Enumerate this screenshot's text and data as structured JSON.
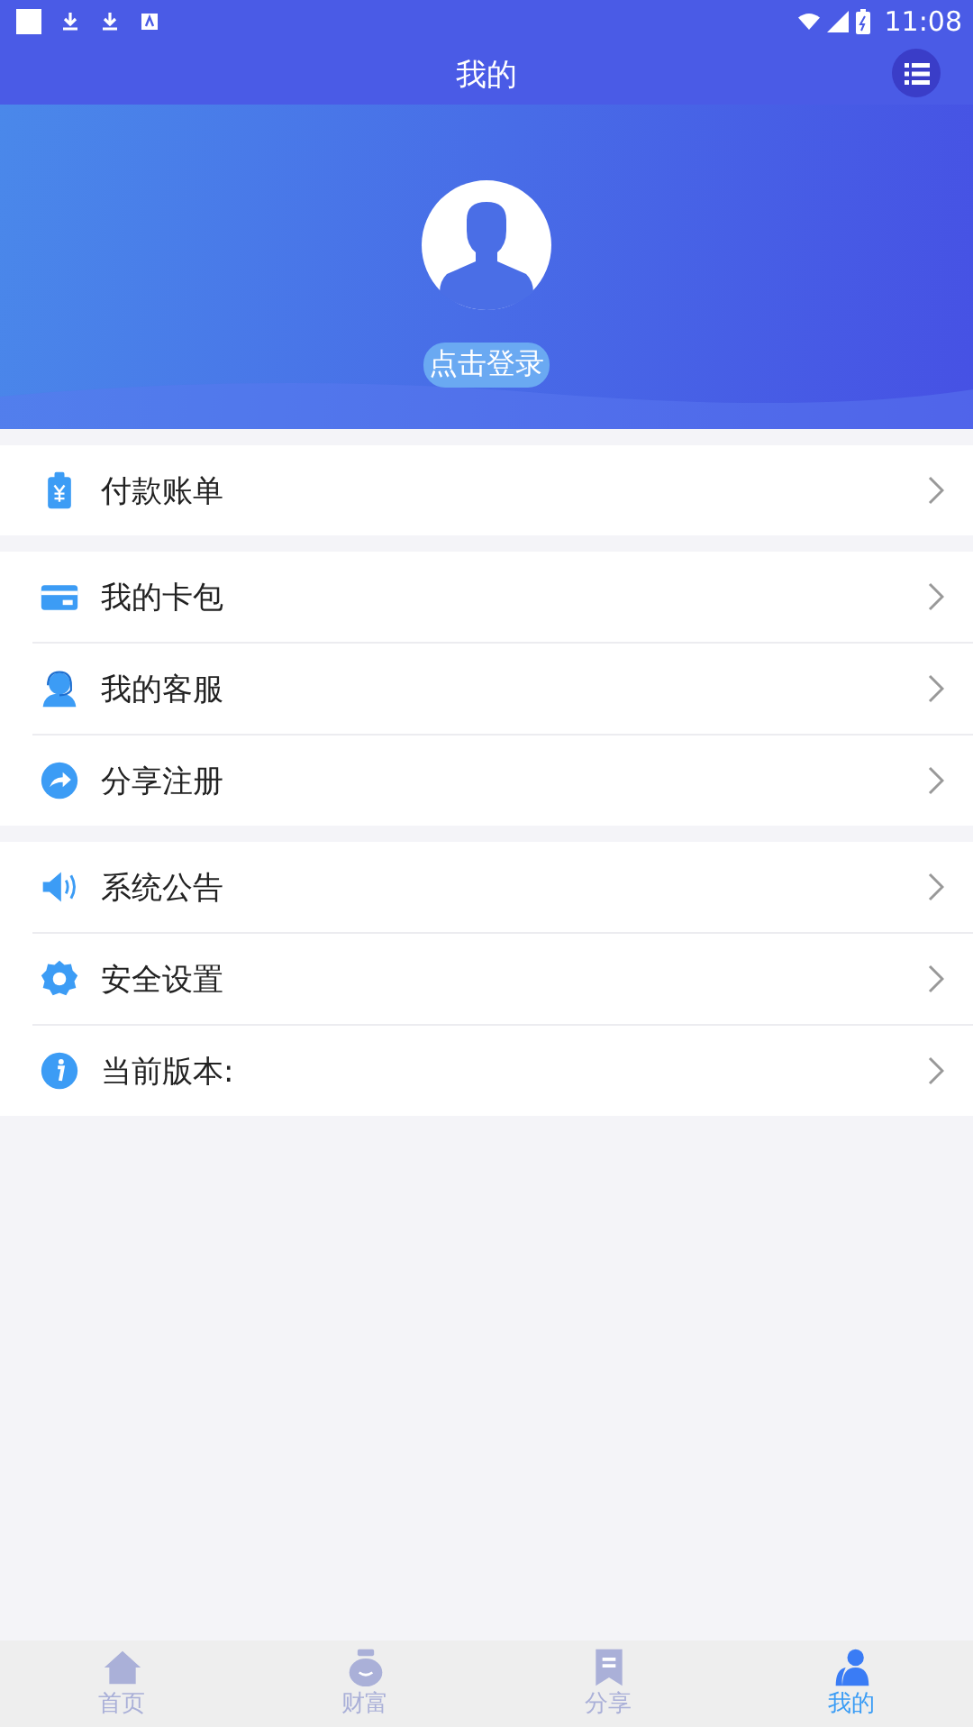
{
  "status_bar": {
    "time": "11:08"
  },
  "header": {
    "title": "我的"
  },
  "profile": {
    "login": "点击登录"
  },
  "menu_groups": [
    [
      {
        "kind": "bill",
        "label": "付款账单"
      }
    ],
    [
      {
        "kind": "card",
        "label": "我的卡包"
      },
      {
        "kind": "service",
        "label": "我的客服"
      },
      {
        "kind": "share",
        "label": "分享注册"
      }
    ],
    [
      {
        "kind": "notice",
        "label": "系统公告"
      },
      {
        "kind": "settings",
        "label": "安全设置"
      },
      {
        "kind": "info",
        "label": "当前版本:"
      }
    ]
  ],
  "tabs": [
    {
      "kind": "home",
      "label": "首页",
      "selected": false
    },
    {
      "kind": "wealth",
      "label": "财富",
      "selected": false
    },
    {
      "kind": "share",
      "label": "分享",
      "selected": false
    },
    {
      "kind": "mine",
      "label": "我的",
      "selected": true
    }
  ]
}
